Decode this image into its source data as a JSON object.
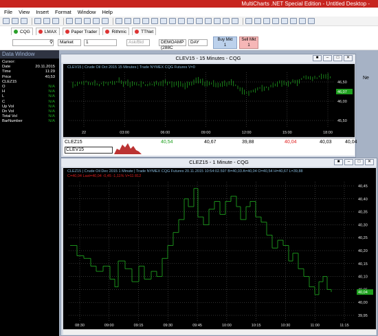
{
  "app": {
    "title": "MultiCharts .NET Special Edition - Untitled Desktop -"
  },
  "menu": [
    "File",
    "View",
    "Insert",
    "Format",
    "Window",
    "Help"
  ],
  "connections": {
    "tabs": [
      {
        "label": "CQG",
        "status": "green"
      },
      {
        "label": "LMAX",
        "status": "red"
      },
      {
        "label": "Paper Trader",
        "status": "red"
      },
      {
        "label": "Rithmic",
        "status": "red"
      },
      {
        "label": "TTNet",
        "status": "red"
      }
    ]
  },
  "trade_bar": {
    "order_type": "Market",
    "quantity": "1",
    "ask_bid": "Ask/Bid",
    "account": "DEMOAMP (288C",
    "duration": "DAY",
    "buy_label": "Buy Mkt",
    "buy_qty": "1",
    "sell_label": "Sell Mkt",
    "sell_qty": "1"
  },
  "data_window": {
    "title": "Data Window",
    "rows": [
      {
        "label": "Cursor:",
        "value": ""
      },
      {
        "label": "Date",
        "value": "20.11.2015"
      },
      {
        "label": "Time",
        "value": "11:29"
      },
      {
        "label": "Price",
        "value": "40,53"
      },
      {
        "label": "CLEZ15",
        "value": ""
      },
      {
        "label": "O",
        "value": "N/A"
      },
      {
        "label": "H",
        "value": "N/A"
      },
      {
        "label": "L",
        "value": "N/A"
      },
      {
        "label": "C",
        "value": "N/A"
      },
      {
        "label": "Up Vol",
        "value": "N/A"
      },
      {
        "label": "Dn Vol",
        "value": "N/A"
      },
      {
        "label": "Total Vol",
        "value": "N/A"
      },
      {
        "label": "BarNumber",
        "value": "N/A"
      }
    ]
  },
  "chart1": {
    "title": "CLEV15 - 15 Minutes - CQG",
    "info": "CLEV15 | Crude Oil Oct 2015  15 Minutes | Trade  NYMEX  CQG  Futures  V=0",
    "price_labels": [
      "46,50",
      "46,00",
      "45,50"
    ],
    "last_price": "46,07",
    "time_labels": [
      "22",
      "03:00",
      "06:00",
      "09:00",
      "12:00",
      "15:00",
      "18:00"
    ]
  },
  "quote_row": {
    "symbol": "CLEZ15",
    "symbol2": "CLEV15",
    "values": [
      "40,54",
      "40,67",
      "39,88",
      "40,04",
      "40,03",
      "40,04"
    ]
  },
  "chart2": {
    "title": "CLEZ15 - 1 Minute - CQG",
    "info": "CLEZ15 | Crude Oil Dec 2015  1 Minute | Trade  NYMEX  CQG  Futures  20.11.2015  10:54:02.597  B=40,03  A=40,04  O=40,54  H=40,67  L=39,88",
    "info2": "C=40,04  Last=40,04  -0,45  -1,11%  V=11 812",
    "price_labels": [
      "40,45",
      "40,40",
      "40,35",
      "40,30",
      "40,25",
      "40,20",
      "40,15",
      "40,10",
      "40,05",
      "40,00",
      "39,95"
    ],
    "last_price": "40,04",
    "time_labels": [
      "08:30",
      "09:00",
      "09:15",
      "09:30",
      "09:45",
      "10:00",
      "10:15",
      "10:30",
      "11:00",
      "11:15"
    ]
  },
  "colors": {
    "accent": "#c7251f",
    "up": "#1ea01e",
    "down": "#e02020",
    "grid": "#6b6b6b"
  }
}
